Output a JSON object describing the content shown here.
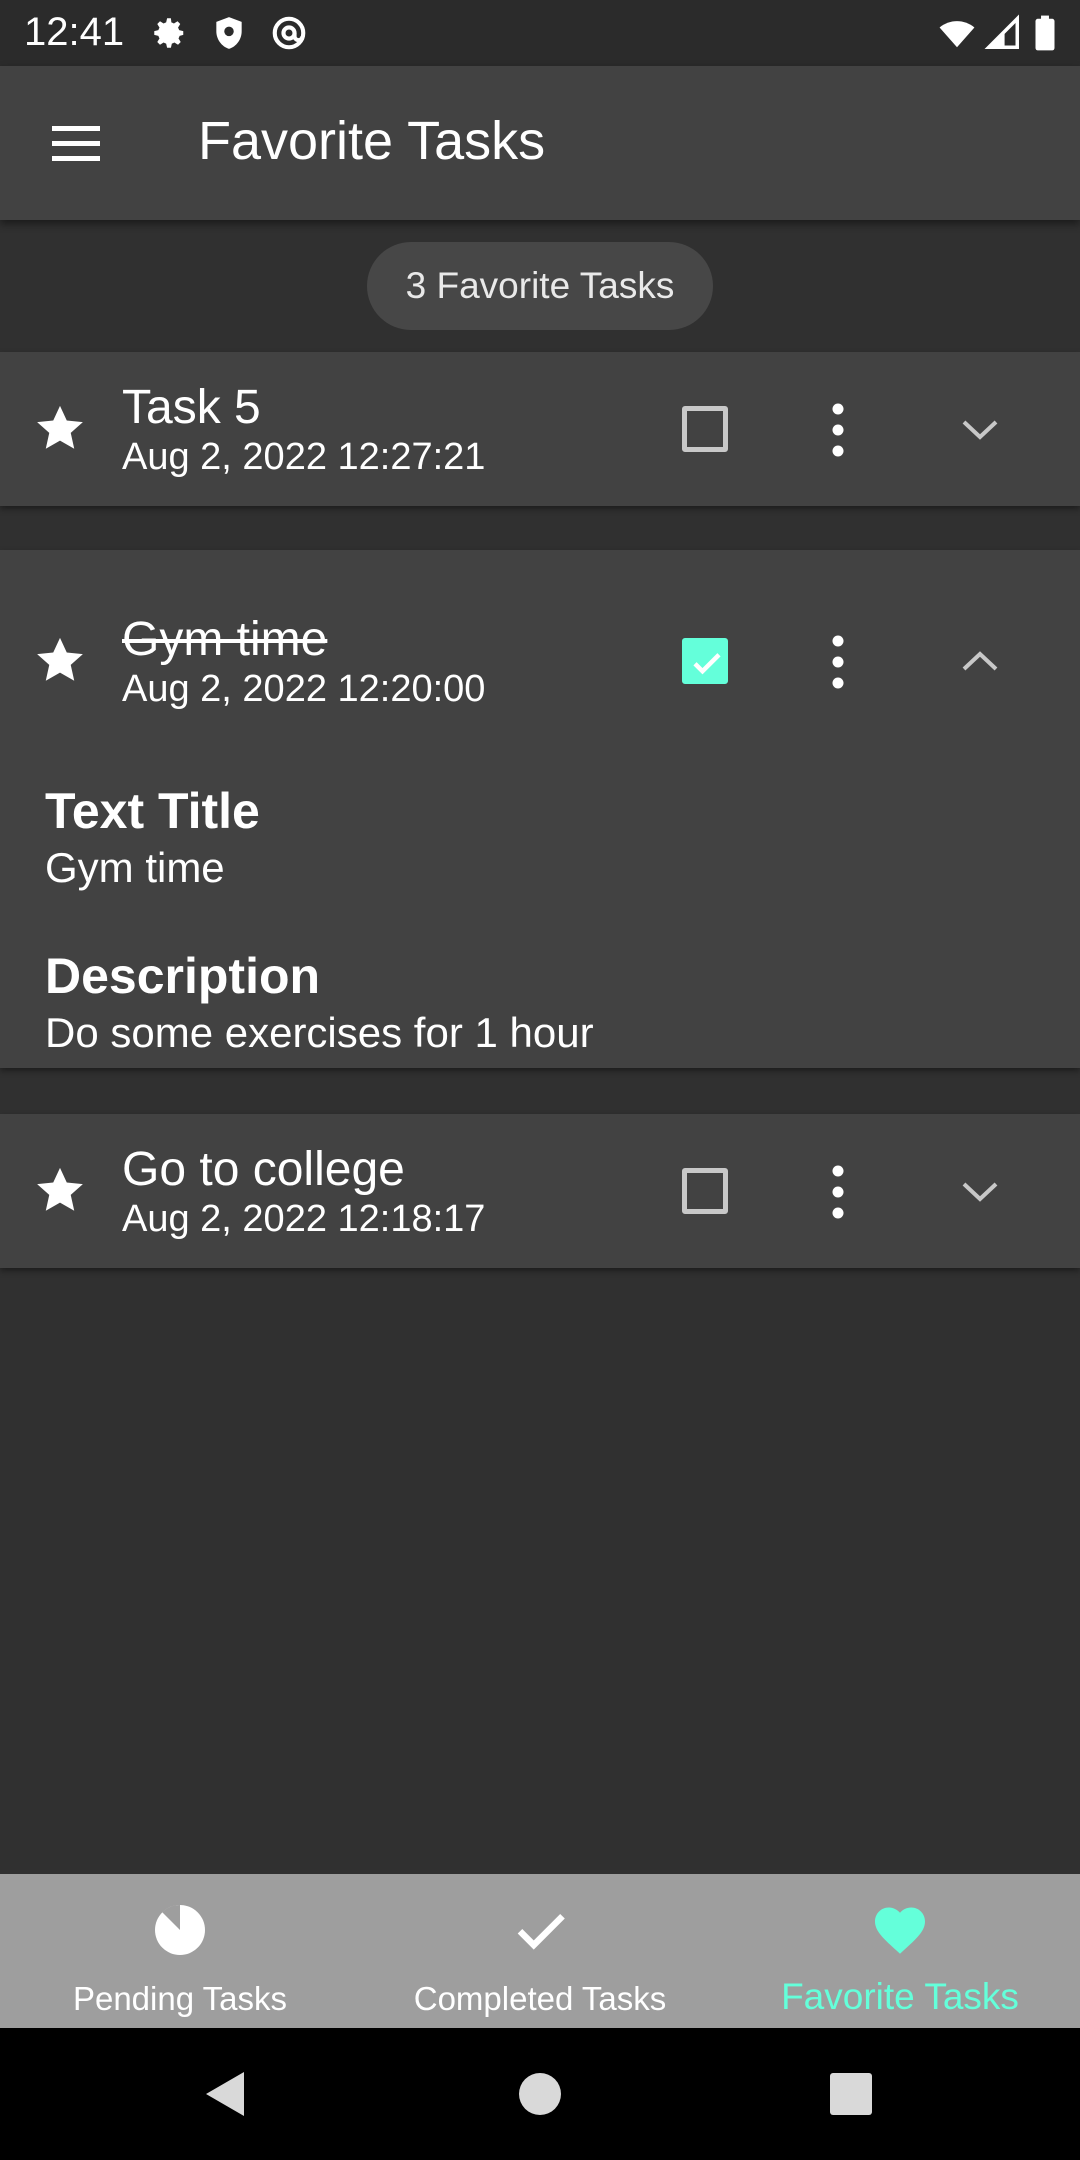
{
  "status_bar": {
    "time": "12:41",
    "icons_left": [
      "gear-icon",
      "shield-icon",
      "at-sign-icon"
    ],
    "icons_right": [
      "wifi-icon",
      "signal-icon",
      "battery-icon"
    ]
  },
  "app_bar": {
    "menu_icon": "menu-icon",
    "title": "Favorite Tasks"
  },
  "count_label": "3 Favorite Tasks",
  "tasks": [
    {
      "title": "Task 5",
      "date": "Aug 2, 2022 12:27:21",
      "completed": false,
      "expanded": false,
      "favorite": true
    },
    {
      "title": "Gym time",
      "date": "Aug 2, 2022 12:20:00",
      "completed": true,
      "expanded": true,
      "favorite": true,
      "details": {
        "title_label": "Text Title",
        "title_value": "Gym time",
        "description_label": "Description",
        "description_value": "Do some exercises for 1 hour"
      }
    },
    {
      "title": "Go to college",
      "date": "Aug 2, 2022 12:18:17",
      "completed": false,
      "expanded": false,
      "favorite": true
    }
  ],
  "bottom_nav": {
    "items": [
      {
        "label": "Pending Tasks",
        "icon": "pie-chart-icon",
        "active": false
      },
      {
        "label": "Completed Tasks",
        "icon": "check-icon",
        "active": false
      },
      {
        "label": "Favorite Tasks",
        "icon": "heart-icon",
        "active": true
      }
    ]
  },
  "colors": {
    "background": "#303030",
    "surface": "#424242",
    "accent": "#64ffda",
    "bottom_nav": "#9e9e9e"
  }
}
